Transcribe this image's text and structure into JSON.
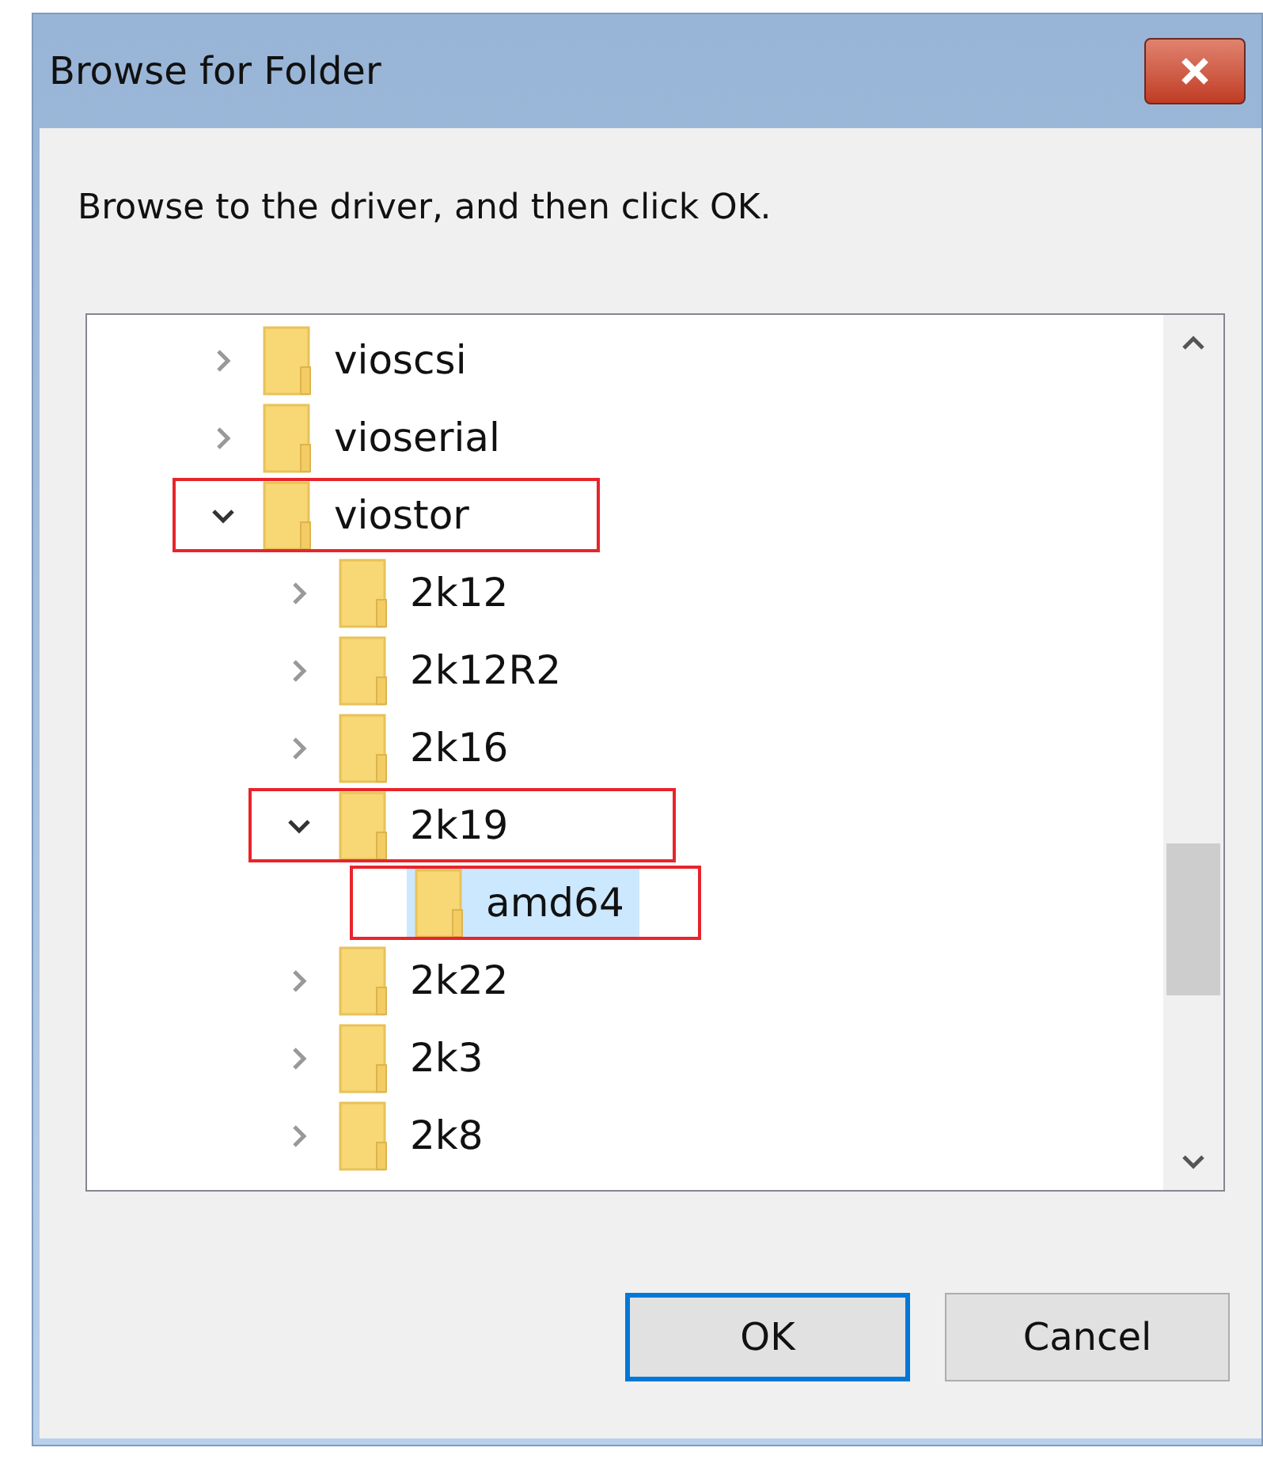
{
  "window": {
    "title": "Browse for Folder"
  },
  "instruction": "Browse to the driver, and then click OK.",
  "tree": [
    {
      "label": "vioscsi",
      "expanded": false,
      "selected": false,
      "highlighted": false
    },
    {
      "label": "vioserial",
      "expanded": false,
      "selected": false,
      "highlighted": false
    },
    {
      "label": "viostor",
      "expanded": true,
      "selected": false,
      "highlighted": true,
      "children": [
        {
          "label": "2k12",
          "expanded": false,
          "selected": false,
          "highlighted": false
        },
        {
          "label": "2k12R2",
          "expanded": false,
          "selected": false,
          "highlighted": false
        },
        {
          "label": "2k16",
          "expanded": false,
          "selected": false,
          "highlighted": false
        },
        {
          "label": "2k19",
          "expanded": true,
          "selected": false,
          "highlighted": true,
          "children": [
            {
              "label": "amd64",
              "selected": true,
              "highlighted": true,
              "leaf": true
            }
          ]
        },
        {
          "label": "2k22",
          "expanded": false,
          "selected": false,
          "highlighted": false
        },
        {
          "label": "2k3",
          "expanded": false,
          "selected": false,
          "highlighted": false
        },
        {
          "label": "2k8",
          "expanded": false,
          "selected": false,
          "highlighted": false
        }
      ]
    }
  ],
  "buttons": [
    {
      "label": "OK",
      "kind": "default"
    },
    {
      "label": "Cancel",
      "kind": "normal"
    }
  ]
}
